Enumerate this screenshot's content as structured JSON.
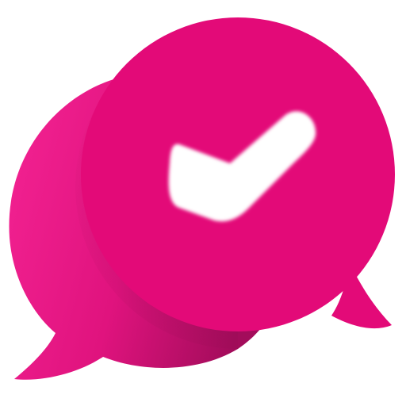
{
  "icon": {
    "name": "chat-check-icon",
    "colors": {
      "primary": "#E30A78",
      "back_bubble_light": "#F42393",
      "back_bubble_dark": "#A30C5B",
      "check": "#FFFFFF",
      "background": "#FFFFFF"
    }
  }
}
